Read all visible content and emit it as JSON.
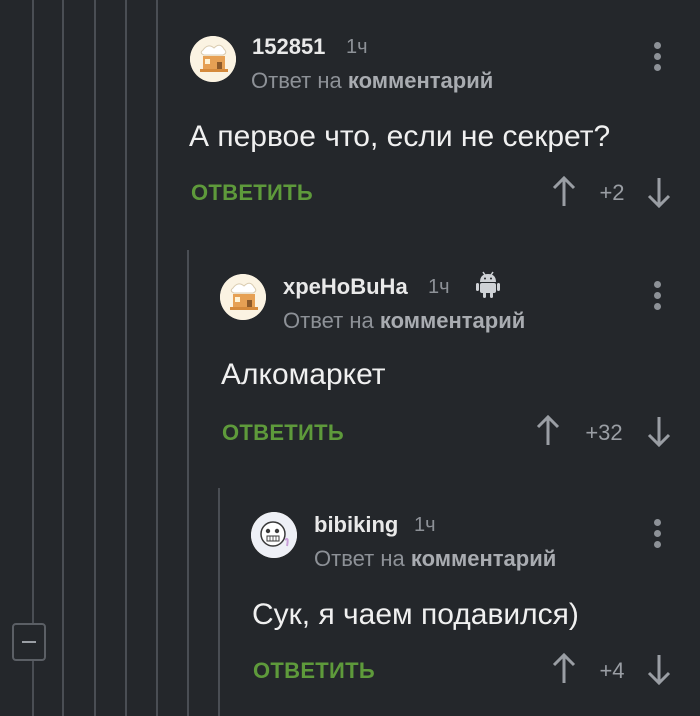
{
  "comments": [
    {
      "author": "152851",
      "time": "1ч",
      "reply_prefix": "Ответ на",
      "reply_target": "комментарий",
      "text": "А первое что, если не секрет?",
      "reply_label": "ОТВЕТИТЬ",
      "score": "+2",
      "avatar_icon": "house-avatar-icon"
    },
    {
      "author": "xpeHoBuHa",
      "time": "1ч",
      "reply_prefix": "Ответ на",
      "reply_target": "комментарий",
      "text": "Алкомаркет",
      "reply_label": "ОТВЕТИТЬ",
      "score": "+32",
      "avatar_icon": "house-avatar-icon",
      "platform_icon": "android-icon"
    },
    {
      "author": "bibiking",
      "time": "1ч",
      "reply_prefix": "Ответ на",
      "reply_target": "комментарий",
      "text": "Сук, я чаем подавился)",
      "reply_label": "ОТВЕТИТЬ",
      "score": "+4",
      "avatar_icon": "character-avatar-icon"
    }
  ],
  "colors": {
    "background": "#24272b",
    "reply_green": "#5e9a3b",
    "thread_line": "#4a4e54",
    "muted_text": "#8d9197"
  }
}
